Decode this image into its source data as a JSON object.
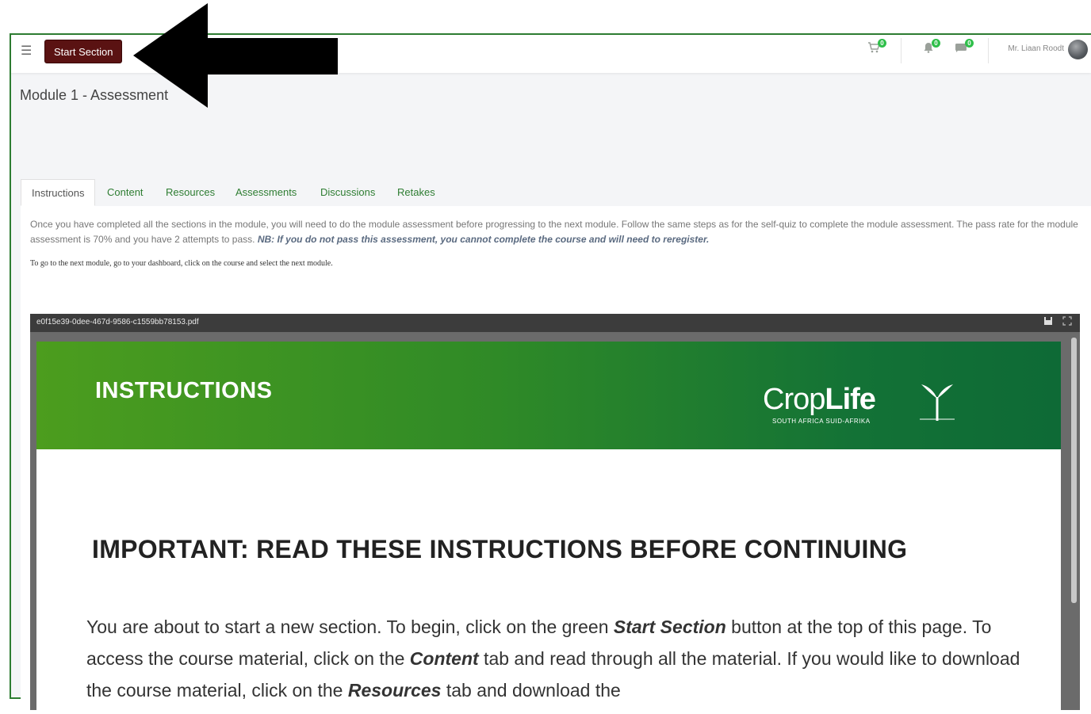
{
  "topbar": {
    "menu_icon": "hamburger-menu-icon",
    "start_section_label": "Start Section",
    "cart_icon": "cart-icon",
    "cart_count": "0",
    "bell_icon": "bell-icon",
    "bell_count": "0",
    "message_icon": "message-icon",
    "message_count": "0",
    "user_name": "Mr. Liaan Roodt",
    "brand_color": "#5a1212"
  },
  "page": {
    "title": "Module 1 - Assessment"
  },
  "tabs": [
    {
      "label": "Instructions",
      "active": true
    },
    {
      "label": "Content"
    },
    {
      "label": "Resources"
    },
    {
      "label": "Assessments"
    },
    {
      "label": "Discussions"
    },
    {
      "label": "Retakes"
    }
  ],
  "instructions": {
    "text_part1": "Once you have completed all the sections in the module, you will need to do the module assessment before progressing to the next module. Follow the same steps as for the self-quiz to complete the module assessment. The pass rate for the module assessment is 70% and you have 2 attempts to pass.",
    "text_bold": "NB: If you do not pass this assessment, you cannot complete the course and will need to reregister.",
    "next_module_note": "To go to the next module, go to your dashboard, click on the course and select the next module."
  },
  "pdf": {
    "file_name": "e0f15e39-0dee-467d-9586-c1559bb78153.pdf",
    "download_icon": "save-icon",
    "fullscreen_icon": "fullscreen-icon",
    "banner_title": "INSTRUCTIONS",
    "logo_crop": "Crop",
    "logo_life": "Life",
    "logo_sub": "SOUTH AFRICA   SUID-AFRIKA",
    "heading": "IMPORTANT: READ THESE INSTRUCTIONS BEFORE CONTINUING",
    "body": [
      {
        "t": "You are about to start a new section. To begin, click on the green "
      },
      {
        "t": "Start Section",
        "b": true
      },
      {
        "t": " button at the top of this page. To access the course material, click on the "
      },
      {
        "t": "Content",
        "b": true
      },
      {
        "t": " tab and read through all the material. If you would like to download the course material, click on the "
      },
      {
        "t": "Resources",
        "b": true
      },
      {
        "t": " tab and download the"
      }
    ]
  },
  "annotation": {
    "arrow_color": "#000000",
    "arrow_icon": "left-arrow-icon"
  }
}
